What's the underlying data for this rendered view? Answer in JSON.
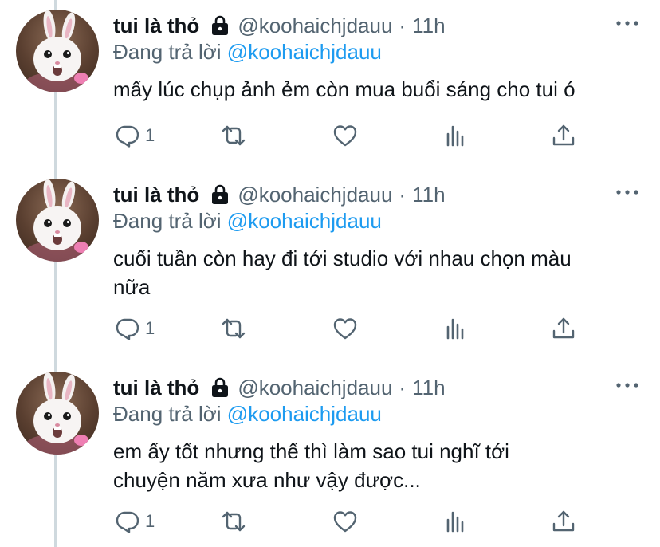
{
  "tweets": [
    {
      "author_name": "tui là thỏ",
      "handle": "@koohaichjdauu",
      "separator": "·",
      "time": "11h",
      "reply_prefix": "Đang trả lời",
      "reply_mention": "@koohaichjdauu",
      "text_lines": [
        "mấy lúc chụp ảnh ẻm còn mua buổi sáng cho tui ó"
      ],
      "reply_count": "1"
    },
    {
      "author_name": "tui là thỏ",
      "handle": "@koohaichjdauu",
      "separator": "·",
      "time": "11h",
      "reply_prefix": "Đang trả lời",
      "reply_mention": "@koohaichjdauu",
      "text_lines": [
        "cuối tuần còn hay đi tới studio với nhau chọn màu",
        "nữa"
      ],
      "reply_count": "1"
    },
    {
      "author_name": "tui là thỏ",
      "handle": "@koohaichjdauu",
      "separator": "·",
      "time": "11h",
      "reply_prefix": "Đang trả lời",
      "reply_mention": "@koohaichjdauu",
      "text_lines": [
        "em ấy tốt nhưng thế thì làm sao tui nghĩ tới",
        "chuyện năm xưa như vậy được..."
      ],
      "reply_count": "1"
    }
  ],
  "icons": {
    "reply": "reply-icon",
    "retweet": "retweet-icon",
    "like": "heart-icon",
    "analytics": "analytics-icon",
    "share": "share-icon",
    "lock": "lock-icon",
    "more": "more-icon"
  },
  "colors": {
    "text": "#0f1419",
    "secondary": "#536471",
    "link": "#1d9bf0",
    "thread_line": "#cfd9de"
  }
}
